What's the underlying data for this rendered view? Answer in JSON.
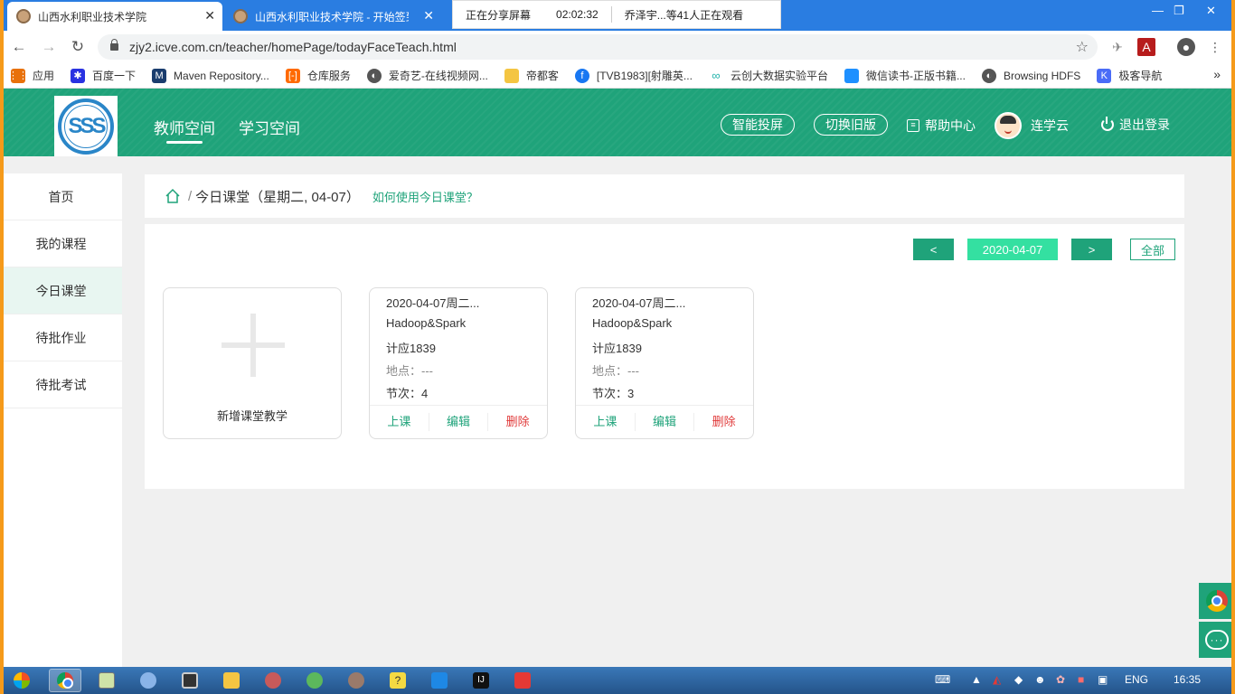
{
  "browser": {
    "tabs": [
      {
        "title": "山西水利职业技术学院",
        "active": true
      },
      {
        "title": "山西水利职业技术学院 - 开始签到",
        "active": false
      }
    ],
    "share_bar": {
      "status": "正在分享屏幕",
      "time": "02:02:32",
      "viewers": "乔泽宇...等41人正在观看"
    },
    "url": "zjy2.icve.com.cn/teacher/homePage/todayFaceTeach.html",
    "bookmarks": [
      {
        "label": "应用",
        "icon": "apps-grid-icon",
        "color": "#e8710a"
      },
      {
        "label": "百度一下",
        "icon": "baidu-paw-icon",
        "color": "#2932e1"
      },
      {
        "label": "Maven Repository...",
        "icon": "maven-icon",
        "color": "#1a3d6e"
      },
      {
        "label": "仓库服务",
        "icon": "aliyun-icon",
        "color": "#ff6a00"
      },
      {
        "label": "爱奇艺-在线视频网...",
        "icon": "globe-icon",
        "color": "#555555"
      },
      {
        "label": "帝都客",
        "icon": "folder-icon",
        "color": "#f4c542"
      },
      {
        "label": "[TVB1983][射雕英...",
        "icon": "facebook-icon",
        "color": "#1877f2"
      },
      {
        "label": "云创大数据实验平台",
        "icon": "cloud-glasses-icon",
        "color": "#20b2aa"
      },
      {
        "label": "微信读书-正版书籍...",
        "icon": "weread-icon",
        "color": "#1e90ff"
      },
      {
        "label": "Browsing HDFS",
        "icon": "globe-icon",
        "color": "#555555"
      },
      {
        "label": "极客导航",
        "icon": "geek-k-icon",
        "color": "#4a6cf7"
      }
    ]
  },
  "header": {
    "nav": [
      "教师空间",
      "学习空间"
    ],
    "smart_cast": "智能投屏",
    "switch_old": "切换旧版",
    "help": "帮助中心",
    "user": "连学云",
    "logout": "退出登录"
  },
  "sidebar": {
    "items": [
      {
        "label": "首页",
        "active": false
      },
      {
        "label": "我的课程",
        "active": false
      },
      {
        "label": "今日课堂",
        "active": true
      },
      {
        "label": "待批作业",
        "active": false
      },
      {
        "label": "待批考试",
        "active": false
      }
    ]
  },
  "breadcrumb": {
    "separator": "/",
    "title": "今日课堂（星期二, 04-07）",
    "help_link": "如何使用今日课堂？"
  },
  "date_nav": {
    "prev": "<",
    "date": "2020-04-07",
    "next": ">",
    "all": "全部"
  },
  "add_card": {
    "label": "新增课堂教学"
  },
  "courses": [
    {
      "date": "2020-04-07周二...",
      "course": "Hadoop&Spark",
      "class": "计应1839",
      "location": "地点：---",
      "period": "节次：4",
      "actions": [
        "上课",
        "编辑",
        "删除"
      ]
    },
    {
      "date": "2020-04-07周二...",
      "course": "Hadoop&Spark",
      "class": "计应1839",
      "location": "地点：---",
      "period": "节次：3",
      "actions": [
        "上课",
        "编辑",
        "删除"
      ]
    }
  ],
  "taskbar": {
    "lang": "ENG",
    "clock": "16:35"
  },
  "colors": {
    "brand": "#1fa37a",
    "accent_light": "#34e0a1",
    "danger": "#e03a3a",
    "chrome_blue": "#2a7de1"
  }
}
